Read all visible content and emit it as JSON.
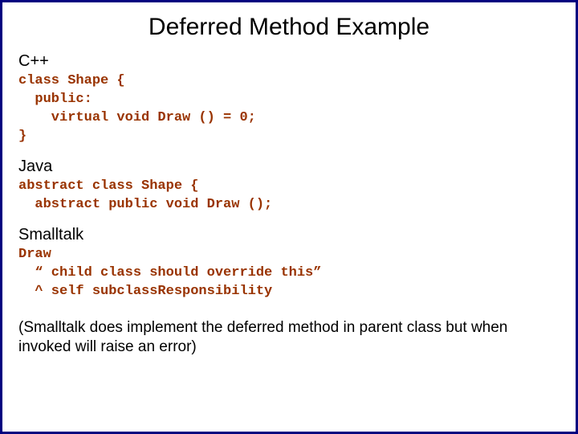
{
  "title": "Deferred Method Example",
  "sections": [
    {
      "label": "C++",
      "code": "class Shape {\n  public:\n    virtual void Draw () = 0;\n}"
    },
    {
      "label": "Java",
      "code": "abstract class Shape {\n  abstract public void Draw ();"
    },
    {
      "label": "Smalltalk",
      "code": "Draw\n  “ child class should override this”\n  ^ self subclassResponsibility"
    }
  ],
  "note": "(Smalltalk does implement the deferred method in parent class but when invoked will raise an error)"
}
